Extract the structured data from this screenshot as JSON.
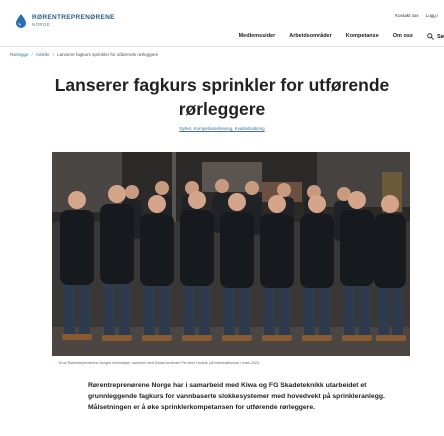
{
  "header": {
    "logo_name": "RØRENTREPRENØRENE",
    "logo_sub": "NORGE",
    "top_links": [
      "Kontakt oss",
      "Logg i"
    ],
    "nav": [
      "Medlemssider",
      "Arbeidsområder",
      "Kompetanse",
      "Om oss"
    ],
    "search_label": "Sø"
  },
  "breadcrumb": [
    "Rørlegge",
    "Artikler",
    "Lanserer fagkurs sprinkler for utførende rørleggere"
  ],
  "article": {
    "title": "Lanserer fagkurs sprinkler for utførende rørleggere",
    "tags": "Nyhet, Kompetanseheving, Kvalitetssikring",
    "caption": "16 av Rørentreprenørene Norges instruktører, sammen med Kiwas kursleder Per Arne Lindvik, på instruktørkurset i mars 2023.",
    "lead": "Rørentreprenørene Norge har i samarbeid med Kiwa og FG Skadeteknikk utarbeidet et grunnleggende fagkurs for vannbaserte slokkesystemer med hovedvekt på sprinkleranlegg. Målsetningen er å øke sprinklerkompetansen for utførende rørleggere."
  },
  "colors": {
    "brand": "#2a5d87",
    "link": "#3e6f9c"
  }
}
